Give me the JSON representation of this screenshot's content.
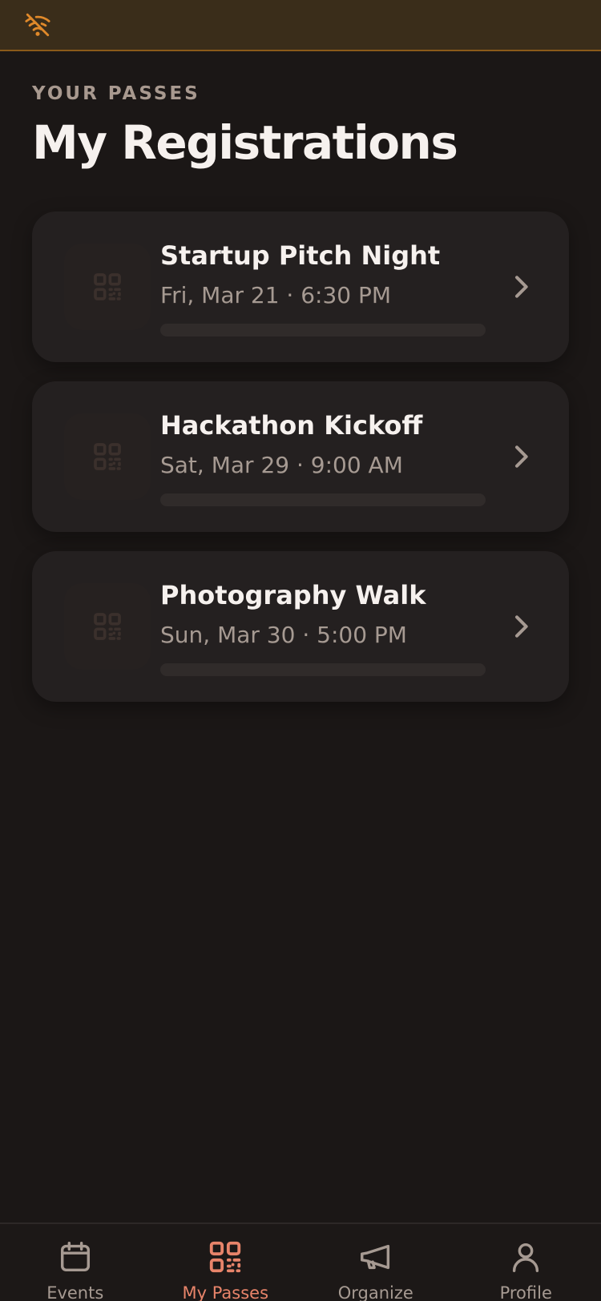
{
  "colors": {
    "background": "#1b1716",
    "card": "#242020",
    "accent": "#e8846a",
    "offline_warning": "#e0892a",
    "muted_text": "#a69a92",
    "title_text": "#f6f1ee"
  },
  "status": {
    "icon": "wifi-off-icon"
  },
  "header": {
    "eyebrow": "YOUR PASSES",
    "title": "My Registrations"
  },
  "registrations": [
    {
      "name": "Startup Pitch Night",
      "when": "Fri, Mar 21 · 6:30 PM",
      "icon": "qr-code-icon",
      "progress": 0
    },
    {
      "name": "Hackathon Kickoff",
      "when": "Sat, Mar 29 · 9:00 AM",
      "icon": "qr-code-icon",
      "progress": 0
    },
    {
      "name": "Photography Walk",
      "when": "Sun, Mar 30 · 5:00 PM",
      "icon": "qr-code-icon",
      "progress": 0
    }
  ],
  "tabs": [
    {
      "label": "Events",
      "icon": "calendar-icon",
      "active": false
    },
    {
      "label": "My Passes",
      "icon": "qr-code-icon",
      "active": true
    },
    {
      "label": "Organize",
      "icon": "megaphone-icon",
      "active": false
    },
    {
      "label": "Profile",
      "icon": "user-icon",
      "active": false
    }
  ]
}
